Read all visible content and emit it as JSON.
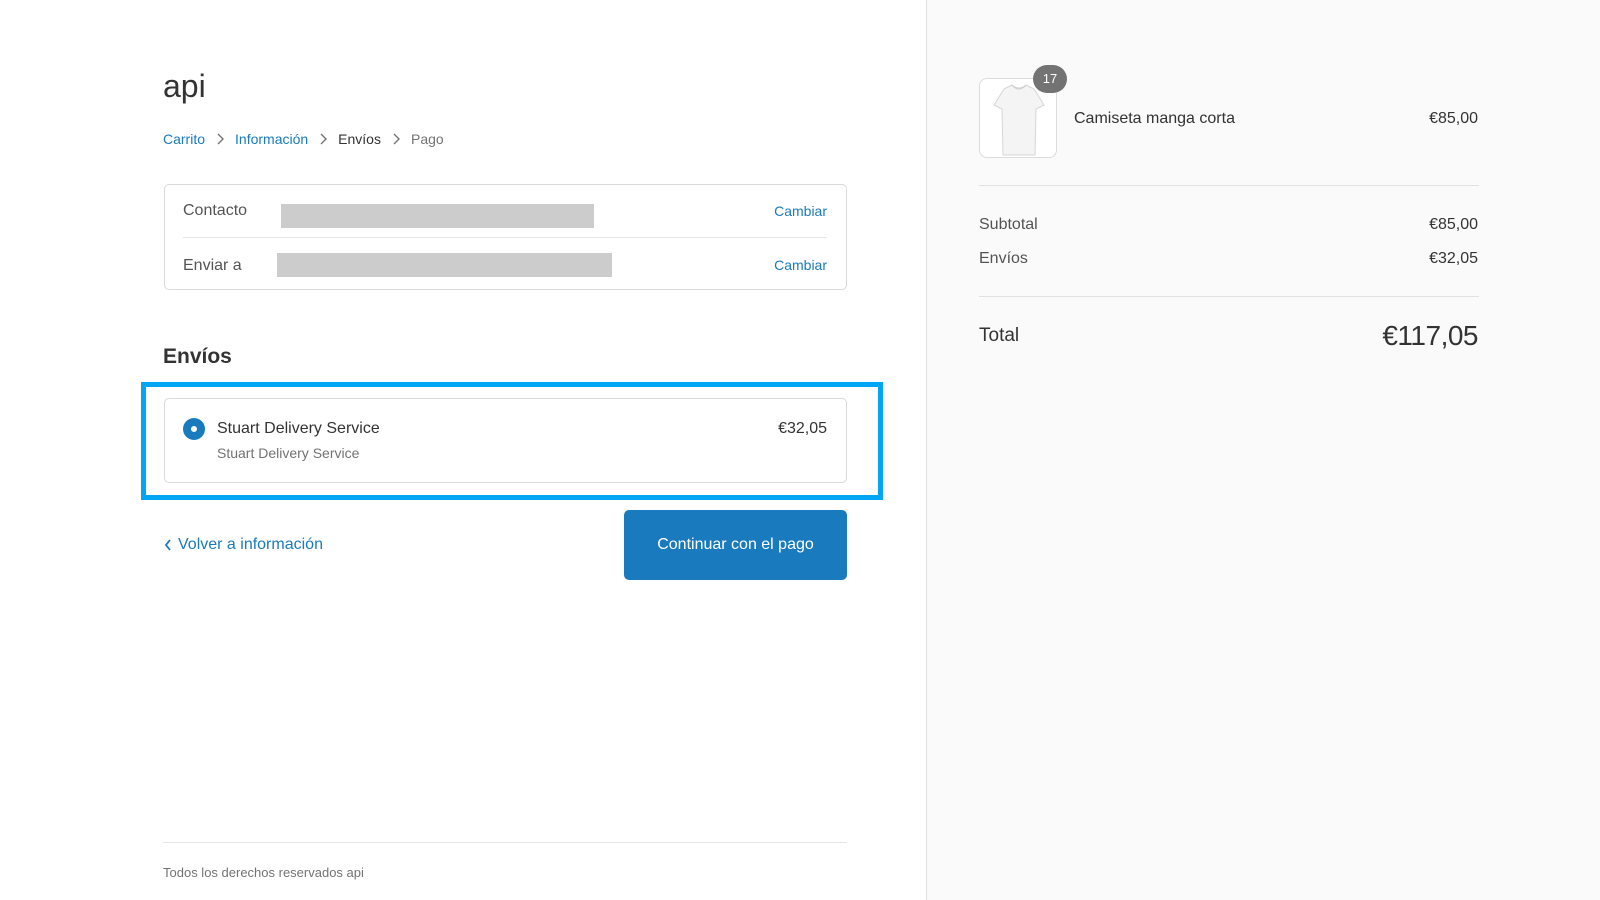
{
  "shop": {
    "title": "api"
  },
  "breadcrumb": {
    "items": [
      {
        "label": "Carrito",
        "state": "link"
      },
      {
        "label": "Información",
        "state": "link"
      },
      {
        "label": "Envíos",
        "state": "current"
      },
      {
        "label": "Pago",
        "state": "disabled"
      }
    ],
    "separator_icon": "chevron-right-icon"
  },
  "review": {
    "contact": {
      "label": "Contacto",
      "value": "",
      "value_redacted": true,
      "action": "Cambiar"
    },
    "ship_to": {
      "label": "Enviar a",
      "value": "",
      "value_redacted": true,
      "action": "Cambiar"
    }
  },
  "shipping": {
    "section_title": "Envíos",
    "options": [
      {
        "name": "Stuart Delivery Service",
        "description": "Stuart Delivery Service",
        "price": "€32,05",
        "selected": true
      }
    ],
    "highlight_color": "#00a6f4"
  },
  "actions": {
    "back_label": "Volver a información",
    "back_icon": "chevron-left-icon",
    "continue_label": "Continuar con el pago"
  },
  "footer": {
    "text": "Todos los derechos reservados api"
  },
  "order_summary": {
    "product": {
      "name": "Camiseta manga corta",
      "price": "€85,00",
      "quantity": "17",
      "image_icon": "t-shirt-icon"
    },
    "subtotal": {
      "label": "Subtotal",
      "value": "€85,00"
    },
    "shipping": {
      "label": "Envíos",
      "value": "€32,05"
    },
    "total": {
      "label": "Total",
      "value": "€117,05"
    }
  },
  "colors": {
    "accent": "#197bbd",
    "sidebar_bg": "#fafafa",
    "redaction": "#cccccc"
  }
}
